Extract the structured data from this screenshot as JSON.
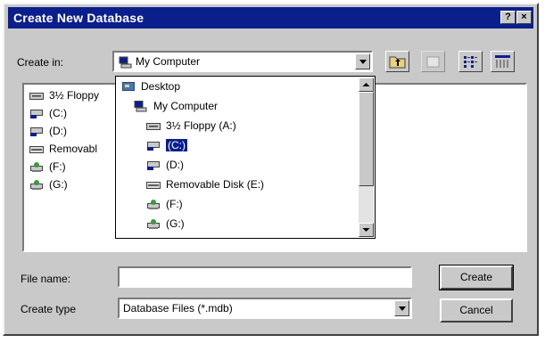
{
  "window": {
    "title": "Create New Database",
    "help_button": "?",
    "close_button": "×"
  },
  "create_in": {
    "label": "Create in:",
    "value": "My Computer"
  },
  "folder_list": [
    {
      "label": "3½ Floppy",
      "icon": "floppy-drive-icon"
    },
    {
      "label": "(C:)",
      "icon": "network-drive-icon"
    },
    {
      "label": "(D:)",
      "icon": "network-drive-icon"
    },
    {
      "label": "Removabl",
      "icon": "removable-disk-icon"
    },
    {
      "label": "(F:)",
      "icon": "shared-drive-icon"
    },
    {
      "label": "(G:)",
      "icon": "shared-drive-icon"
    }
  ],
  "dropdown": {
    "items": [
      {
        "label": "Desktop",
        "icon": "desktop-icon",
        "indent": 0,
        "selected": false
      },
      {
        "label": "My Computer",
        "icon": "computer-icon",
        "indent": 1,
        "selected": false
      },
      {
        "label": "3½ Floppy (A:)",
        "icon": "floppy-drive-icon",
        "indent": 2,
        "selected": false
      },
      {
        "label": "(C:)",
        "icon": "network-drive-icon",
        "indent": 2,
        "selected": true
      },
      {
        "label": "(D:)",
        "icon": "network-drive-icon",
        "indent": 2,
        "selected": false
      },
      {
        "label": "Removable Disk (E:)",
        "icon": "removable-disk-icon",
        "indent": 2,
        "selected": false
      },
      {
        "label": "(F:)",
        "icon": "shared-drive-icon",
        "indent": 2,
        "selected": false
      },
      {
        "label": "(G:)",
        "icon": "shared-drive-icon",
        "indent": 2,
        "selected": false
      }
    ]
  },
  "file_name": {
    "label": "File name:",
    "value": ""
  },
  "create_type": {
    "label": "Create type",
    "value": "Database Files (*.mdb)"
  },
  "buttons": {
    "create": "Create",
    "cancel": "Cancel"
  },
  "colors": {
    "titlebar": "#0a1f8c",
    "dialog": "#c9c9c9",
    "selection": "#0a1f8c"
  }
}
